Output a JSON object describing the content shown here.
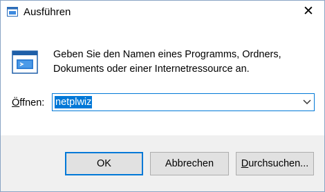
{
  "window": {
    "title": "Ausführen",
    "close_label": "✕"
  },
  "dialog": {
    "message_line1": "Geben Sie den Namen eines Programms, Ordners,",
    "message_line2": "Dokuments oder einer Internetressource an.",
    "open_label_accel": "Ö",
    "open_label_rest": "ffnen:",
    "input_value": "netplwiz"
  },
  "buttons": {
    "ok": "OK",
    "cancel": "Abbrechen",
    "browse_accel": "D",
    "browse_rest": "urchsuchen..."
  },
  "colors": {
    "accent": "#0078d7",
    "footer_bg": "#f0f0f0",
    "button_bg": "#e1e1e1"
  }
}
